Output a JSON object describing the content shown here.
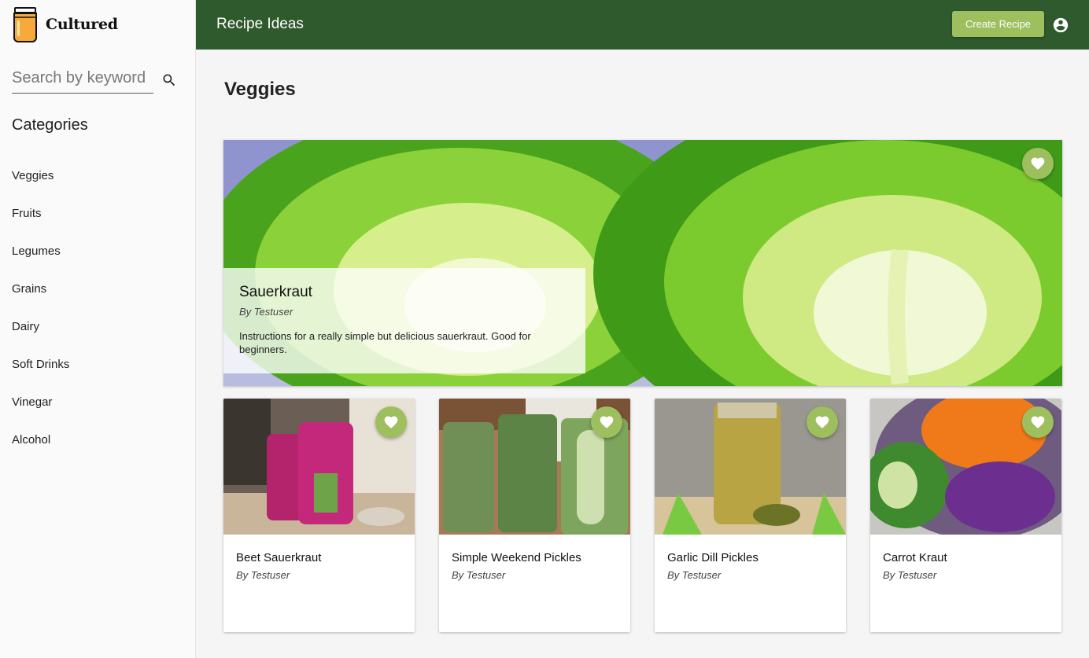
{
  "app": {
    "name": "Cultured",
    "header_title": "Recipe Ideas",
    "create_button": "Create Recipe"
  },
  "search": {
    "placeholder": "Search by keyword"
  },
  "sidebar": {
    "categories_title": "Categories",
    "categories": [
      "Veggies",
      "Fruits",
      "Legumes",
      "Grains",
      "Dairy",
      "Soft Drinks",
      "Vinegar",
      "Alcohol"
    ]
  },
  "page": {
    "title": "Veggies"
  },
  "featured": {
    "title": "Sauerkraut",
    "author": "By Testuser",
    "description": "Instructions for a really simple but delicious sauerkraut. Good for beginners."
  },
  "recipes": [
    {
      "title": "Beet Sauerkraut",
      "author": "By Testuser"
    },
    {
      "title": "Simple Weekend Pickles",
      "author": "By Testuser"
    },
    {
      "title": "Garlic Dill Pickles",
      "author": "By Testuser"
    },
    {
      "title": "Carrot Kraut",
      "author": "By Testuser"
    }
  ],
  "colors": {
    "appbar": "#2e5a2d",
    "accent": "#9dbf5e"
  }
}
